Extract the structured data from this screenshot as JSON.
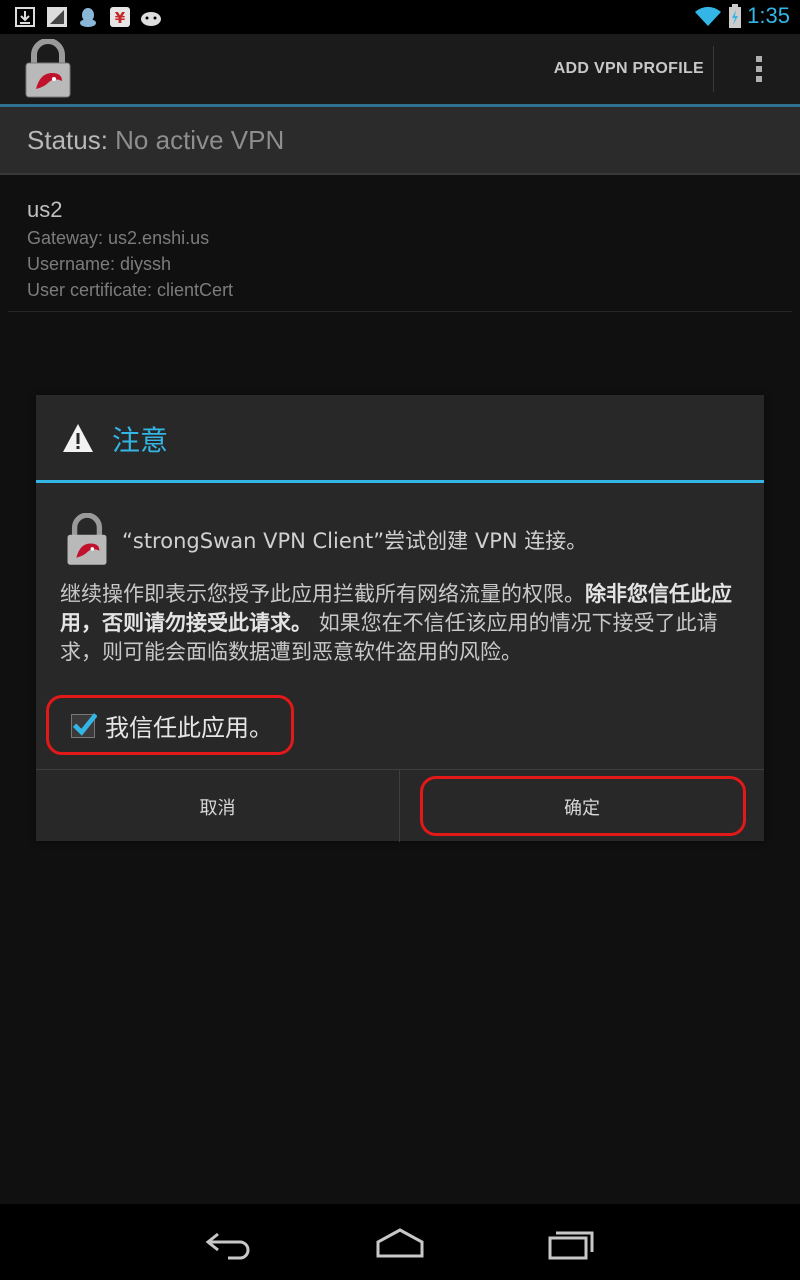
{
  "status_bar": {
    "time": "1:35",
    "notification_icons": [
      "download-icon",
      "signal-app-icon",
      "qq-icon",
      "yen-icon",
      "android-icon"
    ],
    "system_icons": [
      "wifi-icon",
      "battery-charging-icon"
    ]
  },
  "action_bar": {
    "add_profile_label": "ADD VPN PROFILE"
  },
  "status": {
    "label": "Status: ",
    "value": "No active VPN"
  },
  "profile": {
    "name": "us2",
    "gateway": "Gateway: us2.enshi.us",
    "username": "Username: diyssh",
    "certificate": "User certificate: clientCert"
  },
  "dialog": {
    "title": "注意",
    "app_line": "“strongSwan VPN Client”尝试创建 VPN 连接。",
    "message_part1": "继续操作即表示您授予此应用拦截所有网络流量的权限。",
    "message_bold": "除非您信任此应用，否则请勿接受此请求。",
    "message_part2": "如果您在不信任该应用的情况下接受了此请求，则可能会面临数据遭到恶意软件盗用的风险。",
    "checkbox_label": "我信任此应用。",
    "checkbox_checked": true,
    "cancel_label": "取消",
    "ok_label": "确定"
  },
  "colors": {
    "accent": "#33b5e5",
    "highlight": "#e31818"
  }
}
